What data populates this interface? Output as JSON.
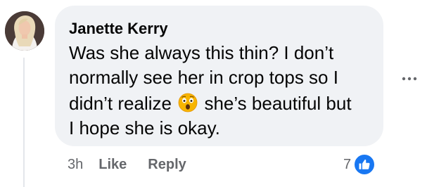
{
  "comment": {
    "author": "Janette Kerry",
    "text_line_1": "Was she always this thin? I don’t",
    "text_line_2": "normally see her in crop tops so I",
    "text_line_3_before": "didn’t realize",
    "text_line_3_after": "she’s beautiful but",
    "text_line_4": "I hope she is okay.",
    "emoji": "astonished-face-emoji"
  },
  "actions": {
    "time": "3h",
    "like_label": "Like",
    "reply_label": "Reply"
  },
  "reactions": {
    "count": "7",
    "icon": "thumbs-up-icon"
  },
  "more_icon": "ellipsis-icon",
  "colors": {
    "bubble": "#f0f2f5",
    "text": "#050505",
    "secondary": "#65676b",
    "like_blue": "#1877f2"
  }
}
